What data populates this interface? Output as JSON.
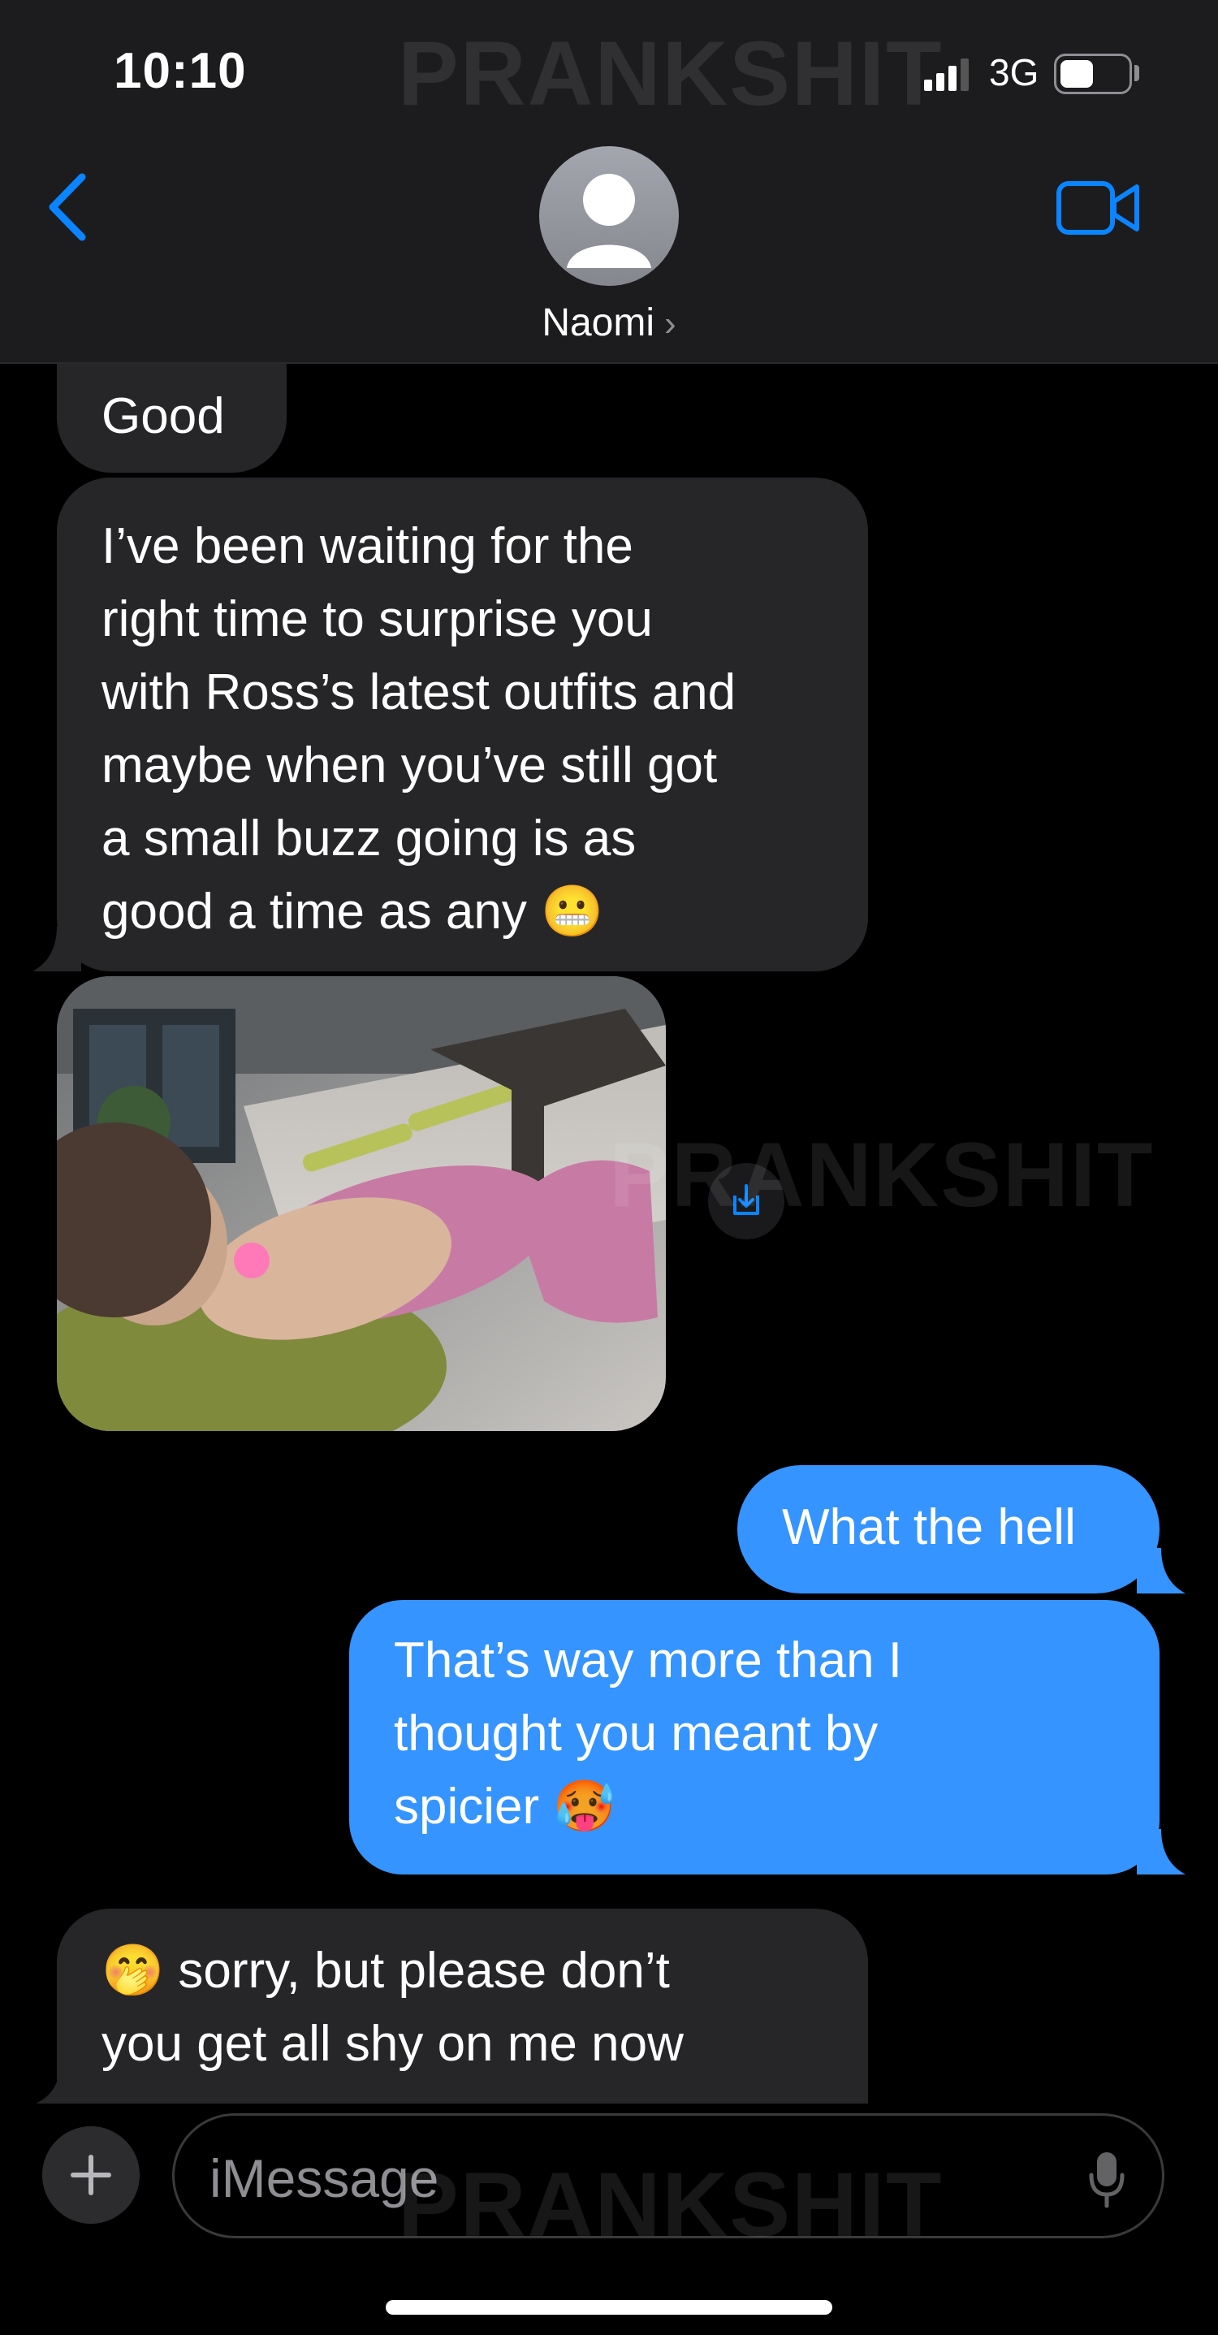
{
  "status_bar": {
    "time": "10:10",
    "network": "3G"
  },
  "header": {
    "contact_name": "Naomi",
    "chevron": "›",
    "back_icon": "chevron-left-icon",
    "video_icon": "video-camera-icon"
  },
  "watermark": "PRANKSHIT",
  "messages": [
    {
      "from": "them",
      "text": "Good"
    },
    {
      "from": "them",
      "text": "I’ve been waiting for the\nright time to surprise you\nwith Ross’s latest outfits and\nmaybe when you’ve still got\na small buzz going is as\ngood a time as any 😬"
    },
    {
      "from": "them",
      "type": "photo"
    },
    {
      "from": "me",
      "text": "What the hell"
    },
    {
      "from": "me",
      "text": "That’s way more than I\nthought you meant by\nspicier 🥵"
    },
    {
      "from": "them",
      "text": "🤭 sorry, but please don’t\nyou get all shy on me now"
    }
  ],
  "composer": {
    "placeholder": "iMessage"
  },
  "colors": {
    "incoming": "#262629",
    "outgoing": "#3594ff",
    "header": "#1c1c1e",
    "accent": "#0a84ff"
  }
}
